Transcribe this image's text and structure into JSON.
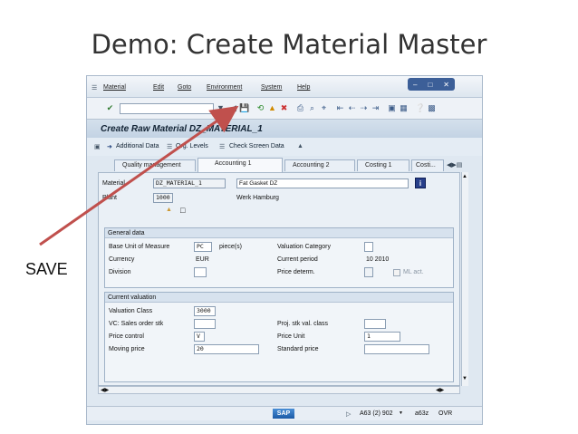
{
  "slide": {
    "title": "Demo: Create Material Master",
    "save_annotation": "SAVE"
  },
  "menu": [
    "Material",
    "Edit",
    "Goto",
    "Environment",
    "System",
    "Help"
  ],
  "window_title": "Create Raw Material DZ_MATERIAL_1",
  "app_toolbar": {
    "additional_data": "Additional Data",
    "org_levels": "Org. Levels",
    "check_screen_data": "Check Screen Data"
  },
  "tabs": [
    "Quality management",
    "Accounting 1",
    "Accounting 2",
    "Costing 1",
    "Costi..."
  ],
  "header_fields": {
    "material_label": "Material",
    "material_value": "DZ_MATERIAL_1",
    "material_desc": "Fat Gasket DZ",
    "plant_label": "Plant",
    "plant_value": "1000",
    "plant_desc": "Werk Hamburg"
  },
  "general_data": {
    "title": "General data",
    "base_uom_label": "Base Unit of Measure",
    "base_uom_value": "PC",
    "base_uom_text": "piece(s)",
    "valuation_category_label": "Valuation Category",
    "currency_label": "Currency",
    "currency_value": "EUR",
    "current_period_label": "Current period",
    "current_period_value": "10  2010",
    "division_label": "Division",
    "price_determ_label": "Price determ.",
    "ml_act_label": "ML act."
  },
  "current_valuation": {
    "title": "Current valuation",
    "valuation_class_label": "Valuation Class",
    "valuation_class_value": "3000",
    "vc_sales_label": "VC: Sales order stk",
    "proj_stk_label": "Proj. stk val. class",
    "price_control_label": "Price control",
    "price_control_value": "V",
    "price_unit_label": "Price Unit",
    "price_unit_value": "1",
    "moving_price_label": "Moving price",
    "moving_price_value": "20",
    "standard_price_label": "Standard price"
  },
  "statusbar": {
    "logo": "SAP",
    "system": "A63 (2) 902",
    "server": "a63z",
    "mode": "OVR"
  },
  "colors": {
    "annotation_arrow": "#c0504d",
    "window_bg": "#dfe8f1",
    "title_bar": "#c3d3e4"
  }
}
